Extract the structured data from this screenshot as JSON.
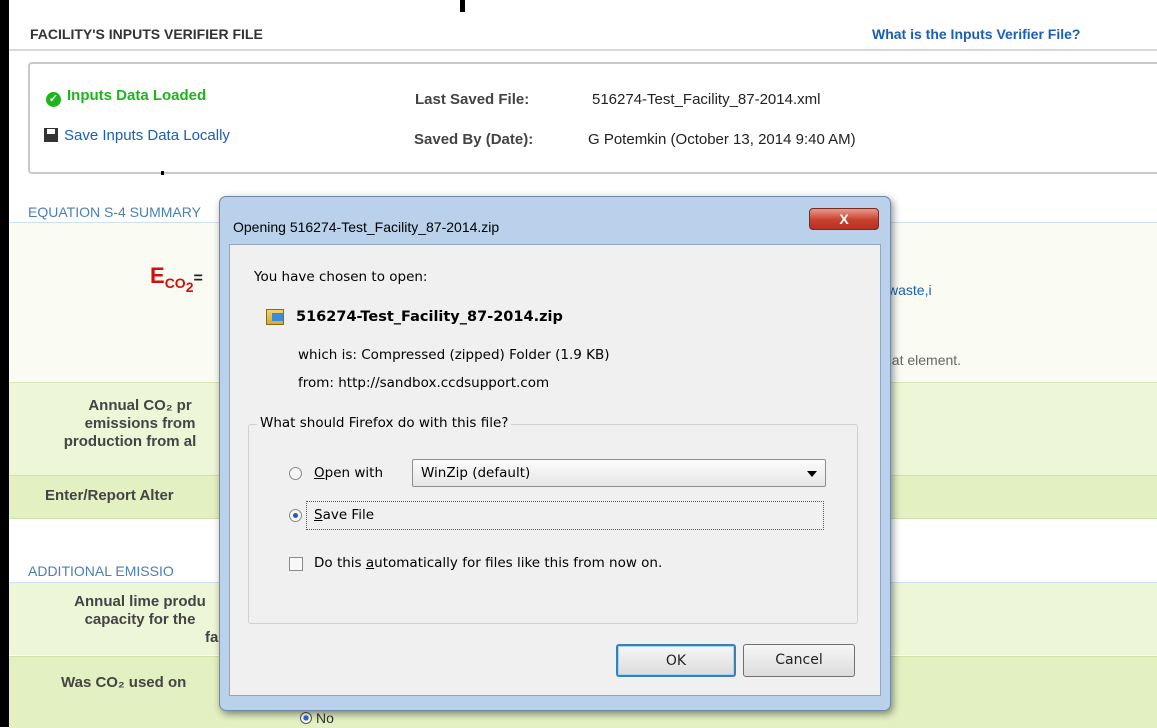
{
  "header": {
    "title": "FACILITY'S INPUTS VERIFIER FILE",
    "help_link": "What is the Inputs Verifier File?"
  },
  "status": {
    "loaded_label": "Inputs Data Loaded",
    "save_link": "Save Inputs Data Locally",
    "last_saved_label": "Last Saved File:",
    "last_saved_value": "516274-Test_Facility_87-2014.xml",
    "saved_by_label": "Saved By (Date):",
    "saved_by_value": "G Potemkin (October 13, 2014 9:40 AM)"
  },
  "background": {
    "eq_section": "EQUATION S-4 SUMMARY",
    "eq_E": "E",
    "eq_sub": "CO",
    "eq_sub2": "2",
    "eq_eq": "=",
    "eq_right": "waste,i",
    "element_text": "hat element.",
    "annual_co2_1": "Annual CO₂ pr",
    "annual_co2_2": "emissions from",
    "annual_co2_3": "production from al",
    "enter_report": "Enter/Report Alter",
    "additional_section": "ADDITIONAL EMISSIO",
    "lime_1": "Annual lime produ",
    "lime_2": "capacity for the",
    "lime_3": "fa",
    "co2_used": "Was CO₂ used on",
    "no_label": "No"
  },
  "dialog": {
    "title": "Opening 516274-Test_Facility_87-2014.zip",
    "close_label": "X",
    "chosen": "You have chosen to open:",
    "filename": "516274-Test_Facility_87-2014.zip",
    "which_is": "which is:  Compressed (zipped) Folder (1.9 KB)",
    "from": "from:  http://sandbox.ccdsupport.com",
    "question": "What should Firefox do with this file?",
    "open_with_mn": "O",
    "open_with_rest": "pen with",
    "app_selected": "WinZip (default)",
    "save_file_mn": "S",
    "save_file_rest": "ave File",
    "auto_pre": "Do this ",
    "auto_mn": "a",
    "auto_rest": "utomatically for files like this from now on.",
    "ok_label": "OK",
    "cancel_label": "Cancel"
  }
}
